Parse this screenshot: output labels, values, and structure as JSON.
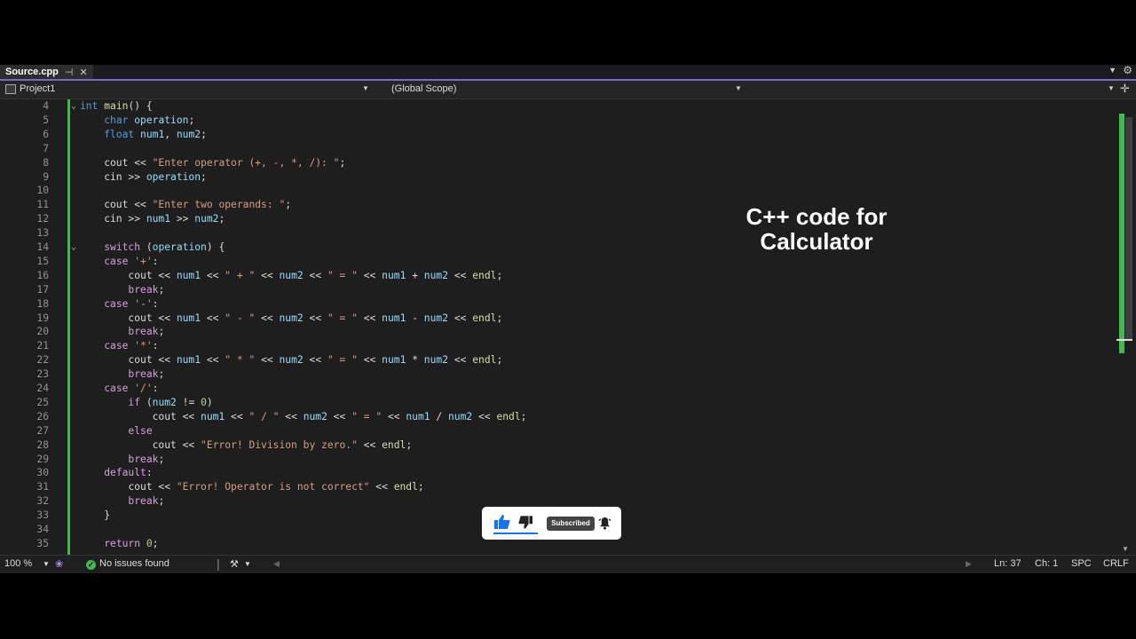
{
  "tab": {
    "title": "Source.cpp",
    "pin_icon": "pin-icon",
    "close_icon": "close-icon"
  },
  "nav": {
    "project": "Project1",
    "scope": "(Global Scope)"
  },
  "code": [
    {
      "n": "4",
      "fold": "⌄",
      "tokens": [
        [
          "kw",
          "int"
        ],
        [
          "plain",
          " "
        ],
        [
          "fn",
          "main"
        ],
        [
          "plain",
          "() {"
        ]
      ]
    },
    {
      "n": "5",
      "fold": "",
      "tokens": [
        [
          "plain",
          "    "
        ],
        [
          "kw",
          "char"
        ],
        [
          "plain",
          " "
        ],
        [
          "var",
          "operation"
        ],
        [
          "plain",
          ";"
        ]
      ]
    },
    {
      "n": "6",
      "fold": "",
      "tokens": [
        [
          "plain",
          "    "
        ],
        [
          "kw",
          "float"
        ],
        [
          "plain",
          " "
        ],
        [
          "var",
          "num1"
        ],
        [
          "plain",
          ", "
        ],
        [
          "var",
          "num2"
        ],
        [
          "plain",
          ";"
        ]
      ]
    },
    {
      "n": "7",
      "fold": "",
      "tokens": []
    },
    {
      "n": "8",
      "fold": "",
      "tokens": [
        [
          "plain",
          "    cout << "
        ],
        [
          "str",
          "\"Enter operator (+, -, *, /): \""
        ],
        [
          "plain",
          ";"
        ]
      ]
    },
    {
      "n": "9",
      "fold": "",
      "tokens": [
        [
          "plain",
          "    cin >> "
        ],
        [
          "var",
          "operation"
        ],
        [
          "plain",
          ";"
        ]
      ]
    },
    {
      "n": "10",
      "fold": "",
      "tokens": []
    },
    {
      "n": "11",
      "fold": "",
      "tokens": [
        [
          "plain",
          "    cout << "
        ],
        [
          "str",
          "\"Enter two operands: \""
        ],
        [
          "plain",
          ";"
        ]
      ]
    },
    {
      "n": "12",
      "fold": "",
      "tokens": [
        [
          "plain",
          "    cin >> "
        ],
        [
          "var",
          "num1"
        ],
        [
          "plain",
          " >> "
        ],
        [
          "var",
          "num2"
        ],
        [
          "plain",
          ";"
        ]
      ]
    },
    {
      "n": "13",
      "fold": "",
      "tokens": []
    },
    {
      "n": "14",
      "fold": "⌄",
      "tokens": [
        [
          "plain",
          "    "
        ],
        [
          "kw2",
          "switch"
        ],
        [
          "plain",
          " ("
        ],
        [
          "var",
          "operation"
        ],
        [
          "plain",
          ") {"
        ]
      ]
    },
    {
      "n": "15",
      "fold": "",
      "tokens": [
        [
          "plain",
          "    "
        ],
        [
          "kw2",
          "case"
        ],
        [
          "plain",
          " "
        ],
        [
          "str",
          "'+'"
        ],
        [
          "plain",
          ":"
        ]
      ]
    },
    {
      "n": "16",
      "fold": "",
      "tokens": [
        [
          "plain",
          "        cout << "
        ],
        [
          "var",
          "num1"
        ],
        [
          "plain",
          " << "
        ],
        [
          "str",
          "\" + \""
        ],
        [
          "plain",
          " << "
        ],
        [
          "var",
          "num2"
        ],
        [
          "plain",
          " << "
        ],
        [
          "str",
          "\" = \""
        ],
        [
          "plain",
          " << "
        ],
        [
          "var",
          "num1"
        ],
        [
          "plain",
          " + "
        ],
        [
          "var",
          "num2"
        ],
        [
          "plain",
          " << "
        ],
        [
          "fn",
          "endl"
        ],
        [
          "plain",
          ";"
        ]
      ]
    },
    {
      "n": "17",
      "fold": "",
      "tokens": [
        [
          "plain",
          "        "
        ],
        [
          "kw2",
          "break"
        ],
        [
          "plain",
          ";"
        ]
      ]
    },
    {
      "n": "18",
      "fold": "",
      "tokens": [
        [
          "plain",
          "    "
        ],
        [
          "kw2",
          "case"
        ],
        [
          "plain",
          " "
        ],
        [
          "str",
          "'-'"
        ],
        [
          "plain",
          ":"
        ]
      ]
    },
    {
      "n": "19",
      "fold": "",
      "tokens": [
        [
          "plain",
          "        cout << "
        ],
        [
          "var",
          "num1"
        ],
        [
          "plain",
          " << "
        ],
        [
          "str",
          "\" - \""
        ],
        [
          "plain",
          " << "
        ],
        [
          "var",
          "num2"
        ],
        [
          "plain",
          " << "
        ],
        [
          "str",
          "\" = \""
        ],
        [
          "plain",
          " << "
        ],
        [
          "var",
          "num1"
        ],
        [
          "plain",
          " - "
        ],
        [
          "var",
          "num2"
        ],
        [
          "plain",
          " << "
        ],
        [
          "fn",
          "endl"
        ],
        [
          "plain",
          ";"
        ]
      ]
    },
    {
      "n": "20",
      "fold": "",
      "tokens": [
        [
          "plain",
          "        "
        ],
        [
          "kw2",
          "break"
        ],
        [
          "plain",
          ";"
        ]
      ]
    },
    {
      "n": "21",
      "fold": "",
      "tokens": [
        [
          "plain",
          "    "
        ],
        [
          "kw2",
          "case"
        ],
        [
          "plain",
          " "
        ],
        [
          "str",
          "'*'"
        ],
        [
          "plain",
          ":"
        ]
      ]
    },
    {
      "n": "22",
      "fold": "",
      "tokens": [
        [
          "plain",
          "        cout << "
        ],
        [
          "var",
          "num1"
        ],
        [
          "plain",
          " << "
        ],
        [
          "str",
          "\" * \""
        ],
        [
          "plain",
          " << "
        ],
        [
          "var",
          "num2"
        ],
        [
          "plain",
          " << "
        ],
        [
          "str",
          "\" = \""
        ],
        [
          "plain",
          " << "
        ],
        [
          "var",
          "num1"
        ],
        [
          "plain",
          " * "
        ],
        [
          "var",
          "num2"
        ],
        [
          "plain",
          " << "
        ],
        [
          "fn",
          "endl"
        ],
        [
          "plain",
          ";"
        ]
      ]
    },
    {
      "n": "23",
      "fold": "",
      "tokens": [
        [
          "plain",
          "        "
        ],
        [
          "kw2",
          "break"
        ],
        [
          "plain",
          ";"
        ]
      ]
    },
    {
      "n": "24",
      "fold": "",
      "tokens": [
        [
          "plain",
          "    "
        ],
        [
          "kw2",
          "case"
        ],
        [
          "plain",
          " "
        ],
        [
          "str",
          "'/'"
        ],
        [
          "plain",
          ":"
        ]
      ]
    },
    {
      "n": "25",
      "fold": "",
      "tokens": [
        [
          "plain",
          "        "
        ],
        [
          "kw2",
          "if"
        ],
        [
          "plain",
          " ("
        ],
        [
          "var",
          "num2"
        ],
        [
          "plain",
          " != "
        ],
        [
          "num",
          "0"
        ],
        [
          "plain",
          ")"
        ]
      ]
    },
    {
      "n": "26",
      "fold": "",
      "tokens": [
        [
          "plain",
          "            cout << "
        ],
        [
          "var",
          "num1"
        ],
        [
          "plain",
          " << "
        ],
        [
          "str",
          "\" / \""
        ],
        [
          "plain",
          " << "
        ],
        [
          "var",
          "num2"
        ],
        [
          "plain",
          " << "
        ],
        [
          "str",
          "\" = \""
        ],
        [
          "plain",
          " << "
        ],
        [
          "var",
          "num1"
        ],
        [
          "plain",
          " / "
        ],
        [
          "var",
          "num2"
        ],
        [
          "plain",
          " << "
        ],
        [
          "fn",
          "endl"
        ],
        [
          "plain",
          ";"
        ]
      ]
    },
    {
      "n": "27",
      "fold": "",
      "tokens": [
        [
          "plain",
          "        "
        ],
        [
          "kw2",
          "else"
        ]
      ]
    },
    {
      "n": "28",
      "fold": "",
      "tokens": [
        [
          "plain",
          "            cout << "
        ],
        [
          "str",
          "\"Error! Division by zero.\""
        ],
        [
          "plain",
          " << "
        ],
        [
          "fn",
          "endl"
        ],
        [
          "plain",
          ";"
        ]
      ]
    },
    {
      "n": "29",
      "fold": "",
      "tokens": [
        [
          "plain",
          "        "
        ],
        [
          "kw2",
          "break"
        ],
        [
          "plain",
          ";"
        ]
      ]
    },
    {
      "n": "30",
      "fold": "",
      "tokens": [
        [
          "plain",
          "    "
        ],
        [
          "kw2",
          "default"
        ],
        [
          "plain",
          ":"
        ]
      ]
    },
    {
      "n": "31",
      "fold": "",
      "tokens": [
        [
          "plain",
          "        cout << "
        ],
        [
          "str",
          "\"Error! Operator is not correct\""
        ],
        [
          "plain",
          " << "
        ],
        [
          "fn",
          "endl"
        ],
        [
          "plain",
          ";"
        ]
      ]
    },
    {
      "n": "32",
      "fold": "",
      "tokens": [
        [
          "plain",
          "        "
        ],
        [
          "kw2",
          "break"
        ],
        [
          "plain",
          ";"
        ]
      ]
    },
    {
      "n": "33",
      "fold": "",
      "tokens": [
        [
          "plain",
          "    }"
        ]
      ]
    },
    {
      "n": "34",
      "fold": "",
      "tokens": []
    },
    {
      "n": "35",
      "fold": "",
      "tokens": [
        [
          "plain",
          "    "
        ],
        [
          "kw2",
          "return"
        ],
        [
          "plain",
          " "
        ],
        [
          "num",
          "0"
        ],
        [
          "plain",
          ";"
        ]
      ]
    }
  ],
  "overlay": {
    "title_line1": "C++ code for",
    "title_line2": "Calculator",
    "subscribed_label": "Subscribed"
  },
  "status": {
    "zoom": "100 %",
    "issues": "No issues found",
    "line": "Ln: 37",
    "col": "Ch: 1",
    "spacing": "SPC",
    "eol": "CRLF"
  },
  "colors": {
    "accent": "#8066c8",
    "change_bar": "#3fb950"
  }
}
